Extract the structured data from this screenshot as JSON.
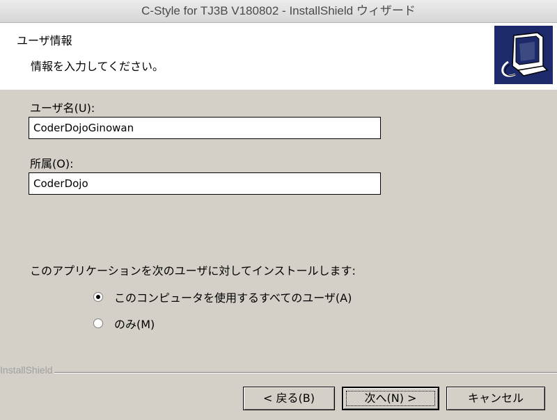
{
  "window": {
    "title": "C-Style for TJ3B V180802 - InstallShield ウィザード"
  },
  "header": {
    "title": "ユーザ情報",
    "subtitle": "情報を入力してください。",
    "logo_icon": "computer-setup-icon",
    "logo_color": "#1c2a6c"
  },
  "form": {
    "user_name": {
      "label": "ユーザ名(U):",
      "value": "CoderDojoGinowan"
    },
    "organization": {
      "label": "所属(O):",
      "value": "CoderDojo"
    }
  },
  "install_for": {
    "label": "このアプリケーションを次のユーザに対してインストールします:",
    "options": [
      {
        "label": "このコンピュータを使用するすべてのユーザ(A)",
        "checked": true
      },
      {
        "label": "のみ(M)",
        "checked": false
      }
    ]
  },
  "footer": {
    "brand": "InstallShield",
    "buttons": {
      "back": "< 戻る(B)",
      "next": "次へ(N) >",
      "cancel": "キャンセル"
    }
  }
}
